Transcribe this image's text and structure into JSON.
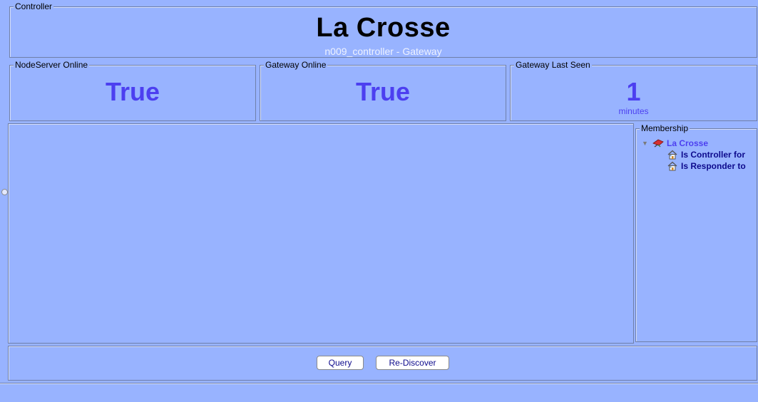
{
  "controller": {
    "legend": "Controller",
    "title": "La Crosse",
    "subtitle": "n009_controller - Gateway"
  },
  "status_panels": [
    {
      "legend": "NodeServer Online",
      "value": "True",
      "unit": ""
    },
    {
      "legend": "Gateway Online",
      "value": "True",
      "unit": ""
    },
    {
      "legend": "Gateway Last Seen",
      "value": "1",
      "unit": "minutes"
    }
  ],
  "membership": {
    "legend": "Membership",
    "root_label": "La Crosse",
    "children": [
      "Is Controller for",
      "Is Responder to"
    ]
  },
  "buttons": {
    "query_label": "Query",
    "rediscover_label": "Re-Discover"
  },
  "colors": {
    "background": "#98b3ff",
    "accent": "#4c3ff0",
    "link": "#0d0a8c"
  }
}
